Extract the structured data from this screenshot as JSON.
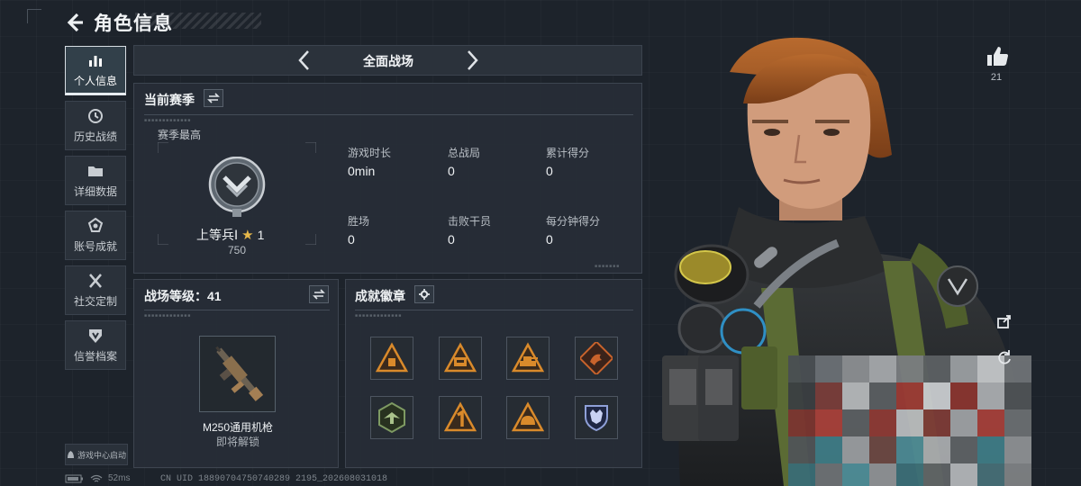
{
  "header": {
    "title": "角色信息"
  },
  "nav": {
    "items": [
      {
        "label": "个人信息",
        "icon": "bar-chart-icon",
        "active": true
      },
      {
        "label": "历史战绩",
        "icon": "clock-icon",
        "active": false
      },
      {
        "label": "详细数据",
        "icon": "folder-icon",
        "active": false
      },
      {
        "label": "账号成就",
        "icon": "medal-icon",
        "active": false
      },
      {
        "label": "社交定制",
        "icon": "tools-icon",
        "active": false
      },
      {
        "label": "信誉档案",
        "icon": "shield-icon",
        "active": false
      }
    ]
  },
  "mode": {
    "title": "全面战场"
  },
  "season": {
    "title": "当前赛季",
    "best_label": "赛季最高",
    "rank_name": "上等兵Ⅰ",
    "stars": "1",
    "rank_points": "750",
    "stats": [
      {
        "label": "游戏时长",
        "value": "0min"
      },
      {
        "label": "总战局",
        "value": "0"
      },
      {
        "label": "累计得分",
        "value": "0"
      },
      {
        "label": "胜场",
        "value": "0"
      },
      {
        "label": "击败干员",
        "value": "0"
      },
      {
        "label": "每分钟得分",
        "value": "0"
      }
    ]
  },
  "battlefield": {
    "title": "战场等级：41",
    "weapon_name": "M250通用机枪",
    "weapon_status": "即将解锁"
  },
  "achievements": {
    "title": "成就徽章",
    "badges": [
      {
        "icon": "tent-badge-icon",
        "color": "#d98a2b"
      },
      {
        "icon": "vehicle-badge-icon",
        "color": "#d98a2b"
      },
      {
        "icon": "tank-badge-icon",
        "color": "#d98a2b"
      },
      {
        "icon": "dragon-badge-icon",
        "color": "#c8632c"
      },
      {
        "icon": "eagle-badge-icon",
        "color": "#7e9a62"
      },
      {
        "icon": "rank-one-badge-icon",
        "color": "#d98a2b"
      },
      {
        "icon": "helmet-badge-icon",
        "color": "#d98a2b"
      },
      {
        "icon": "wolf-shield-badge-icon",
        "color": "#5a6fb3"
      }
    ]
  },
  "likes": {
    "count": "21"
  },
  "footer": {
    "status_button": "游戏中心启动",
    "ping": "52ms",
    "uid": "CN UID 18890704750740289 2195_202608031018"
  },
  "colors": {
    "accent": "#eef1f3",
    "badge_orange": "#d98a2b",
    "panel": "#272e37"
  }
}
